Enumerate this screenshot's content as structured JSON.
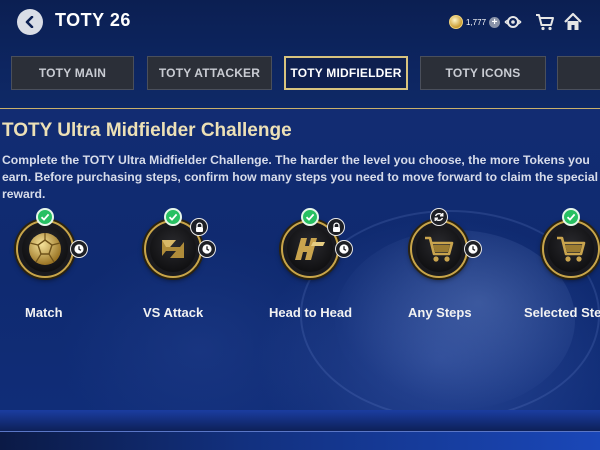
{
  "header": {
    "title": "TOTY 26",
    "coins": "1,777"
  },
  "tabs": [
    {
      "label": "TOTY MAIN",
      "active": false
    },
    {
      "label": "TOTY ATTACKER",
      "active": false
    },
    {
      "label": "TOTY MIDFIELDER",
      "active": true
    },
    {
      "label": "TOTY ICONS",
      "active": false
    }
  ],
  "challenge": {
    "title": "TOTY Ultra Midfielder Challenge",
    "description": "Complete the TOTY Ultra Midfielder Challenge. The harder the level you choose, the more Tokens you earn. Before purchasing steps, confirm how many steps you need to move forward to claim the special reward."
  },
  "steps": [
    {
      "label": "Match",
      "icon": "gold-ball-icon",
      "completed": true,
      "locked": false
    },
    {
      "label": "VS Attack",
      "icon": "vs-attack-icon",
      "completed": true,
      "locked": true
    },
    {
      "label": "Head to Head",
      "icon": "head-to-head-icon",
      "completed": true,
      "locked": true
    },
    {
      "label": "Any Steps",
      "icon": "shopping-cart-icon",
      "completed": false,
      "locked": false
    },
    {
      "label": "Selected Steps",
      "icon": "shopping-cart-icon",
      "completed": true,
      "locked": false
    }
  ],
  "colors": {
    "accent_gold": "#d8c37e",
    "check_green": "#27c062",
    "background_blue": "#0f2a70"
  }
}
